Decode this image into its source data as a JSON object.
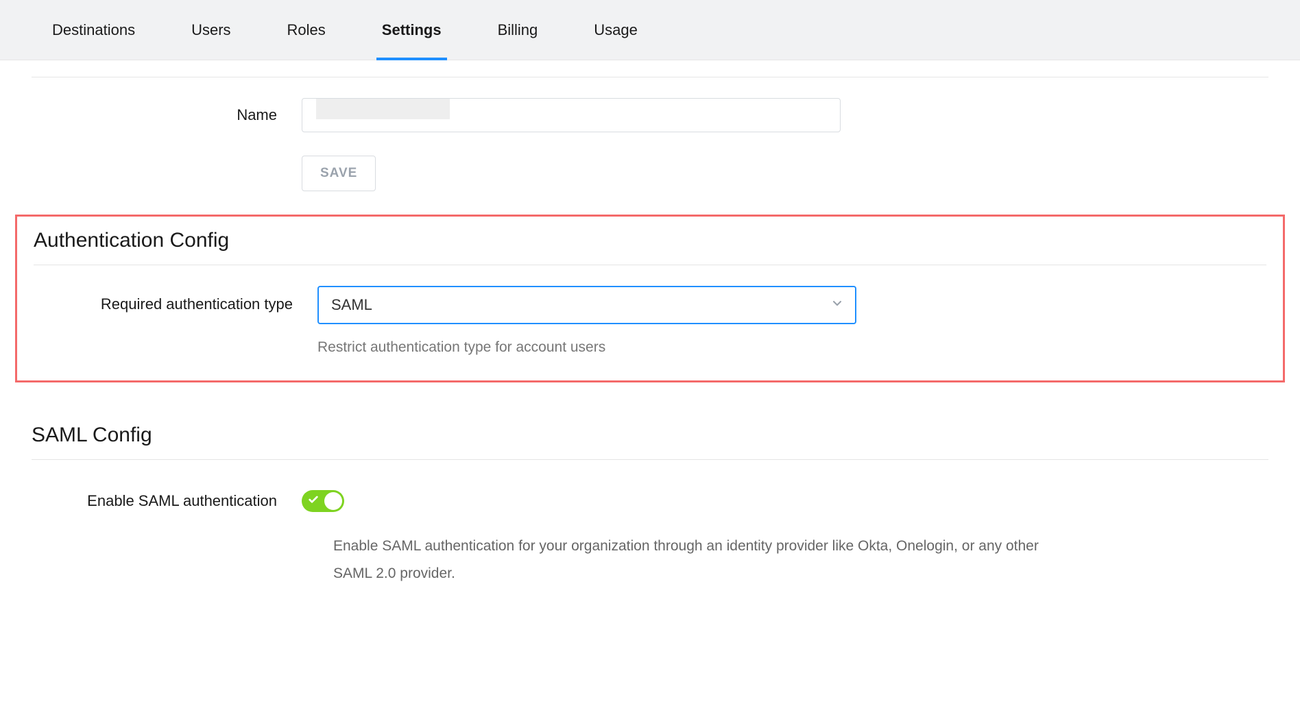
{
  "tabs": [
    {
      "label": "Destinations",
      "active": false
    },
    {
      "label": "Users",
      "active": false
    },
    {
      "label": "Roles",
      "active": false
    },
    {
      "label": "Settings",
      "active": true
    },
    {
      "label": "Billing",
      "active": false
    },
    {
      "label": "Usage",
      "active": false
    }
  ],
  "name_section": {
    "label": "Name",
    "value": "",
    "save_label": "SAVE"
  },
  "auth_config": {
    "title": "Authentication Config",
    "field_label": "Required authentication type",
    "selected_value": "SAML",
    "helper": "Restrict authentication type for account users"
  },
  "saml_config": {
    "title": "SAML Config",
    "toggle_label": "Enable SAML authentication",
    "toggle_on": true,
    "helper": "Enable SAML authentication for your organization through an identity provider like Okta, Onelogin, or any other SAML 2.0 provider."
  }
}
